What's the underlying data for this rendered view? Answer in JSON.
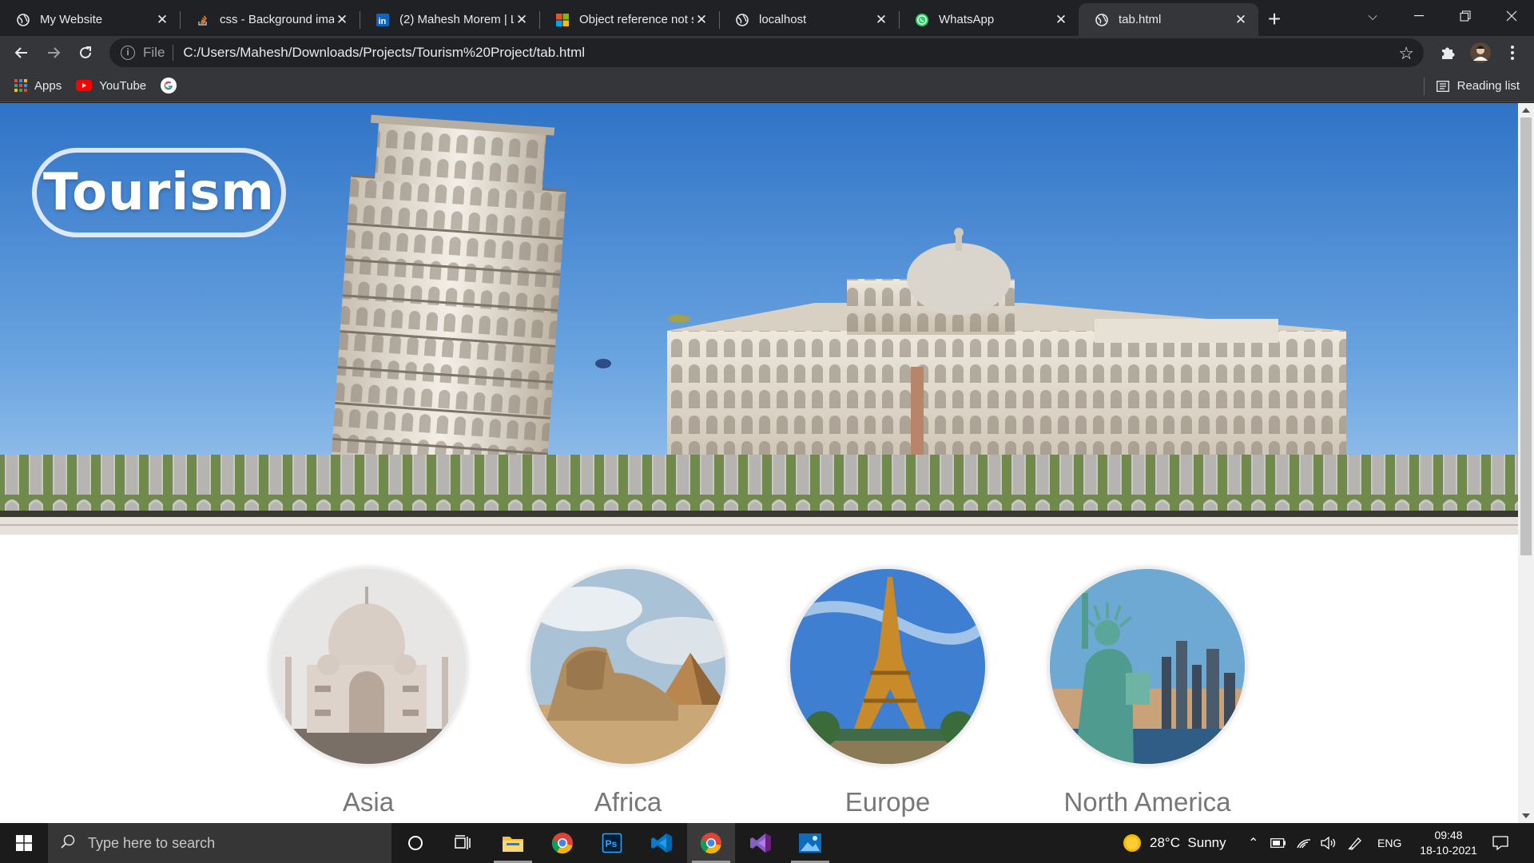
{
  "browser": {
    "tabs": [
      {
        "title": "My Website",
        "icon": "globe-icon",
        "active": false
      },
      {
        "title": "css - Background ima",
        "icon": "stackoverflow-icon",
        "active": false
      },
      {
        "title": "(2) Mahesh Morem | L",
        "icon": "linkedin-icon",
        "active": false
      },
      {
        "title": "Object reference not s",
        "icon": "microsoft-icon",
        "active": false
      },
      {
        "title": "localhost",
        "icon": "globe-icon",
        "active": false
      },
      {
        "title": "WhatsApp",
        "icon": "whatsapp-icon",
        "active": false
      },
      {
        "title": "tab.html",
        "icon": "globe-icon",
        "active": true
      }
    ],
    "address": {
      "scheme": "File",
      "url": "C:/Users/Mahesh/Downloads/Projects/Tourism%20Project/tab.html"
    },
    "bookmarks": [
      {
        "label": "Apps",
        "icon": "apps-grid-icon"
      },
      {
        "label": "YouTube",
        "icon": "youtube-icon"
      },
      {
        "label": "",
        "icon": "google-icon"
      }
    ],
    "reading_list": "Reading list"
  },
  "page": {
    "logo": "Tourism",
    "continents": [
      {
        "name": "Asia",
        "icon": "taj-mahal-image"
      },
      {
        "name": "Africa",
        "icon": "sphinx-pyramid-image"
      },
      {
        "name": "Europe",
        "icon": "eiffel-tower-image"
      },
      {
        "name": "North America",
        "icon": "statue-of-liberty-image"
      }
    ]
  },
  "taskbar": {
    "search_placeholder": "Type here to search",
    "weather": "28°C  Sunny",
    "language": "ENG",
    "time": "09:48",
    "date": "18-10-2021"
  }
}
